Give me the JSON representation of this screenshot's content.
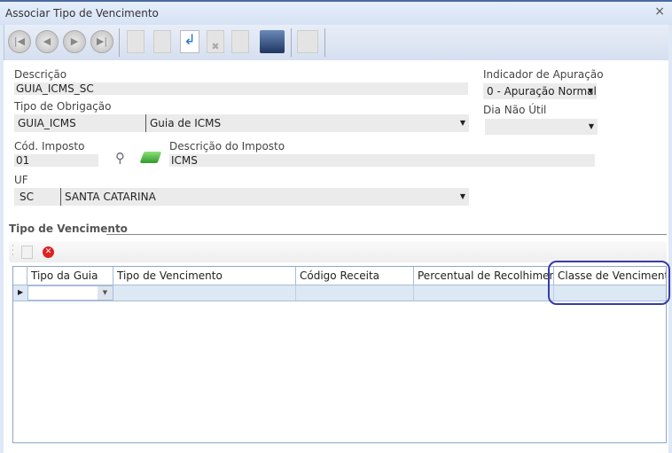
{
  "window": {
    "title": "Associar Tipo de Vencimento",
    "close": "×"
  },
  "toolbar": {
    "buttons": [
      "first",
      "previous",
      "next",
      "last",
      "new",
      "edit",
      "undo",
      "delete",
      "redo",
      "save",
      "lock"
    ]
  },
  "form": {
    "descricao_label": "Descrição",
    "descricao_value": "GUIA_ICMS_SC",
    "tipo_obrigacao_label": "Tipo de Obrigação",
    "tipo_obrigacao_code": "GUIA_ICMS",
    "tipo_obrigacao_desc": "Guia de ICMS",
    "cod_imposto_label": "Cód. Imposto",
    "cod_imposto_value": "01",
    "desc_imposto_label": "Descrição do Imposto",
    "desc_imposto_value": "ICMS",
    "uf_label": "UF",
    "uf_code": "SC",
    "uf_name": "SANTA CATARINA",
    "indicador_label": "Indicador de Apuração",
    "indicador_value": "0 - Apuração Normal",
    "dia_nao_util_label": "Dia Não Útil",
    "dia_nao_util_value": ""
  },
  "section": {
    "title": "Tipo de Vencimento"
  },
  "grid": {
    "columns": [
      "Tipo da Guia",
      "Tipo de Vencimento",
      "Código Receita",
      "Percentual de Recolhimento",
      "Classe de Vencimento"
    ],
    "rows": [
      [
        "",
        "",
        "",
        "",
        ""
      ]
    ]
  },
  "colors": {
    "highlight": "#3a3aa8"
  }
}
